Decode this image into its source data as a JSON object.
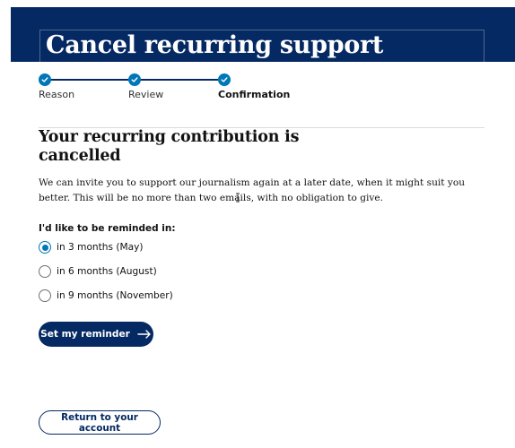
{
  "header": {
    "title": "Cancel recurring support"
  },
  "stepper": {
    "steps": [
      {
        "label": "Reason",
        "completed": true
      },
      {
        "label": "Review",
        "completed": true
      },
      {
        "label": "Confirmation",
        "completed": true,
        "active": true
      }
    ]
  },
  "main": {
    "heading": "Your recurring contribution is cancelled",
    "intro": "We can invite you to support our journalism again at a later date, when it might suit you better. This will be no more than two emails, with no obligation to give.",
    "reminder_label": "I'd like to be reminded in:",
    "options": [
      {
        "label": "in 3 months (May)",
        "checked": true
      },
      {
        "label": "in 6 months (August)",
        "checked": false
      },
      {
        "label": "in 9 months (November)",
        "checked": false
      }
    ],
    "set_reminder_button": "Set my reminder",
    "return_button": "Return to your account"
  },
  "icons": {
    "check": "check-icon",
    "arrow": "arrow-right-icon"
  },
  "colors": {
    "brand_navy": "#052962",
    "accent_blue": "#0077b6",
    "text": "#121212"
  }
}
